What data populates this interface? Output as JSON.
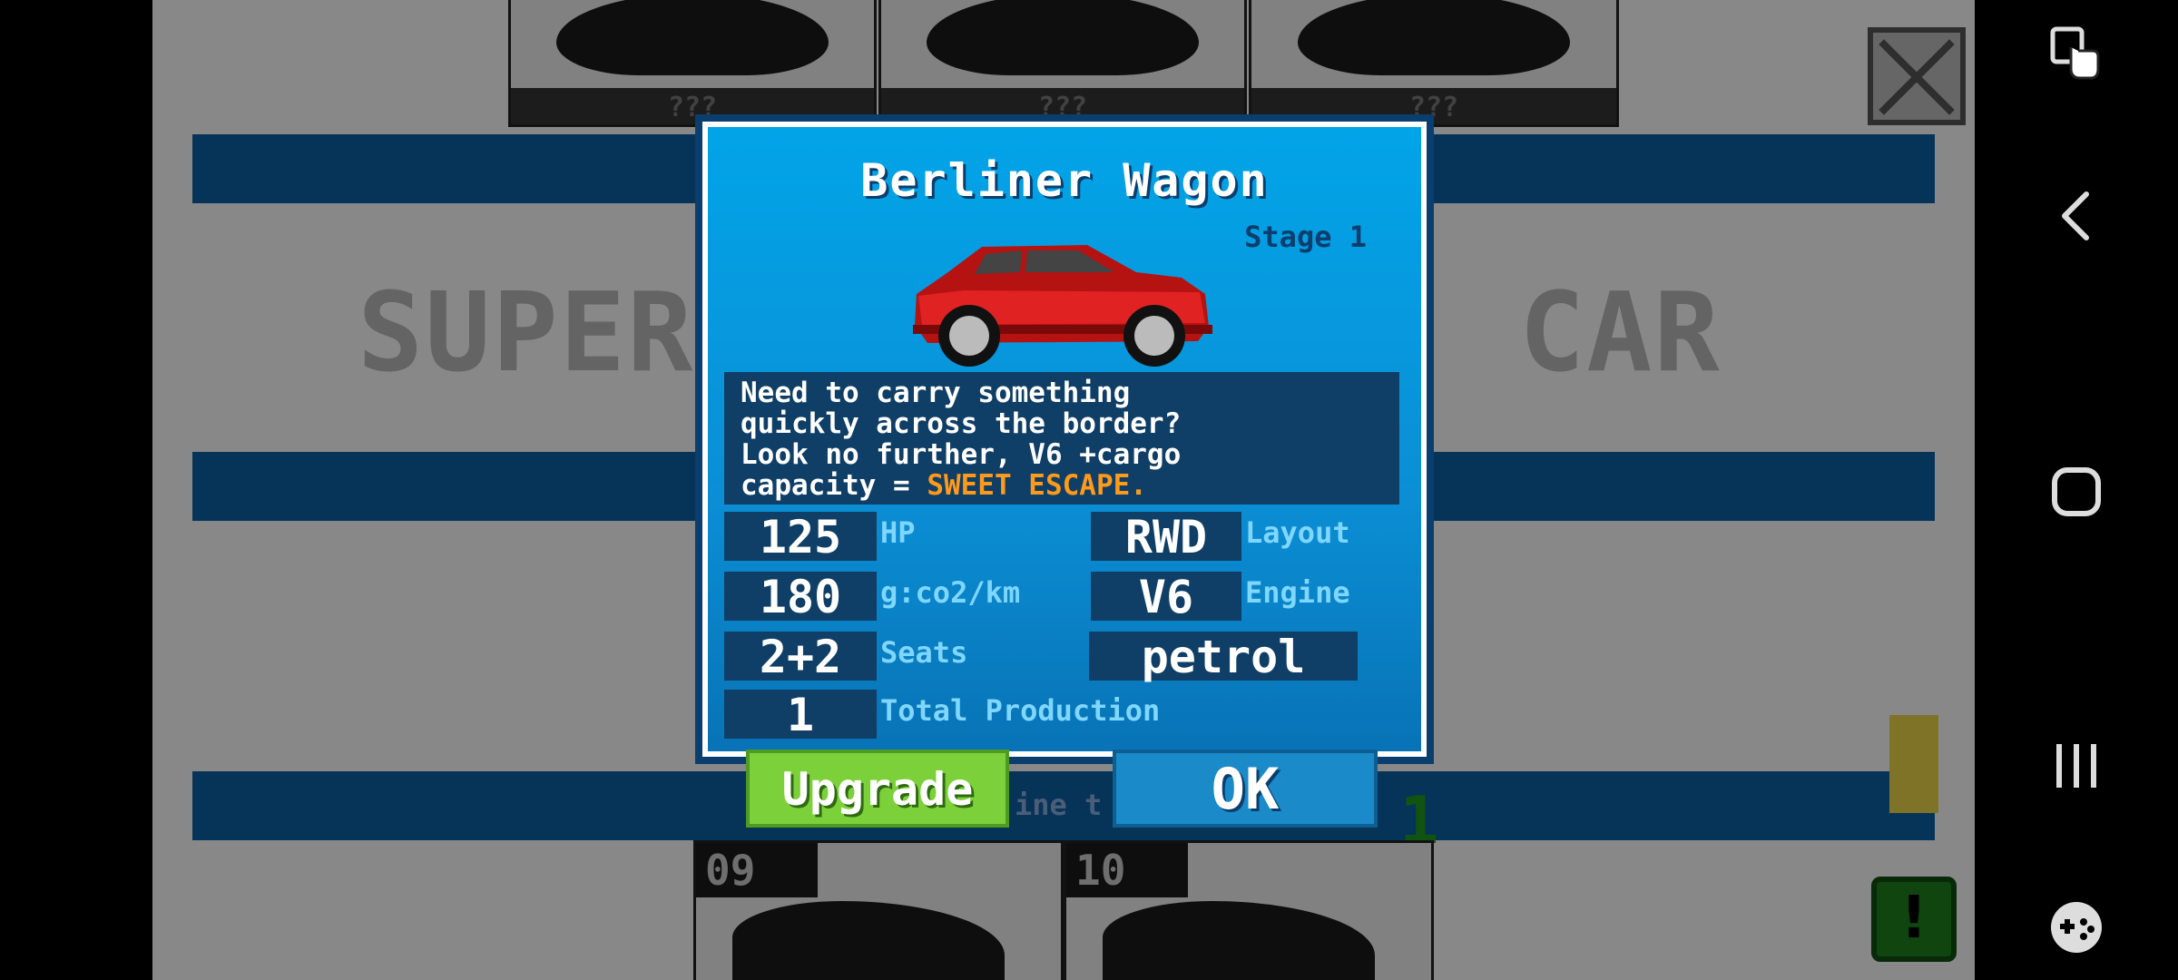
{
  "background": {
    "top_cards": [
      {
        "caption": "???"
      },
      {
        "caption": "???"
      },
      {
        "caption": "???"
      }
    ],
    "category_left": "SUPER",
    "category_right": "CAR",
    "behind_text": "ine t",
    "green_digit": "1",
    "tiles": [
      {
        "number": "09"
      },
      {
        "number": "10"
      }
    ],
    "alert_symbol": "!"
  },
  "modal": {
    "car_name": "Berliner Wagon",
    "stage": "Stage 1",
    "description_lines": [
      "Need to carry something",
      "quickly across the border?",
      "Look no further, V6 +cargo",
      "capacity = "
    ],
    "description_highlight": "SWEET ESCAPE.",
    "stats": {
      "hp": {
        "value": "125",
        "label": "HP"
      },
      "emissions": {
        "value": "180",
        "label": "g:co2/km"
      },
      "seats": {
        "value": "2+2",
        "label": "Seats"
      },
      "production": {
        "value": "1",
        "label": "Total Production"
      },
      "layout": {
        "value": "RWD",
        "label": "Layout"
      },
      "engine": {
        "value": "V6",
        "label": "Engine"
      },
      "fuel": {
        "value": "petrol"
      }
    },
    "buttons": {
      "upgrade": "Upgrade",
      "ok": "OK"
    }
  },
  "navbar": {
    "icons": [
      "accessibility-touch-icon",
      "back-icon",
      "home-icon",
      "recents-icon",
      "game-launcher-icon"
    ]
  },
  "colors": {
    "modal_blue": "#02a4e8",
    "panel_dark": "#0f3e66",
    "highlight_orange": "#ff9a1a",
    "upgrade_green": "#7cd13a",
    "ok_blue": "#1a8ac8",
    "label_cyan": "#7fd6ff"
  }
}
